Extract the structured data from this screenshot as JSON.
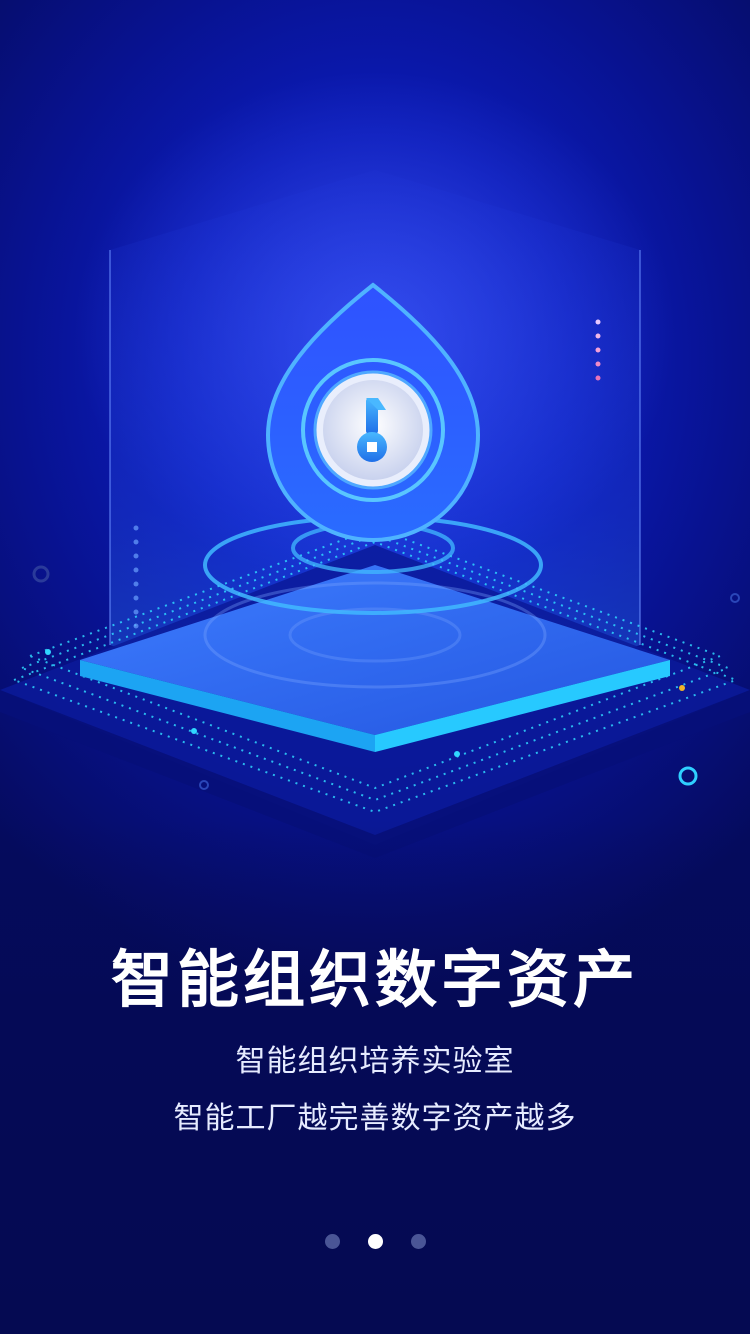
{
  "onboarding": {
    "title": "智能组织数字资产",
    "subtitle_line1": "智能组织培养实验室",
    "subtitle_line2": "智能工厂越完善数字资产越多"
  },
  "pager": {
    "total_pages": 3,
    "active_index": 1
  },
  "illustration": {
    "icon": "key-lock-drop-icon",
    "accent_color": "#3aa8ff",
    "cyan_color": "#35e0ff"
  }
}
